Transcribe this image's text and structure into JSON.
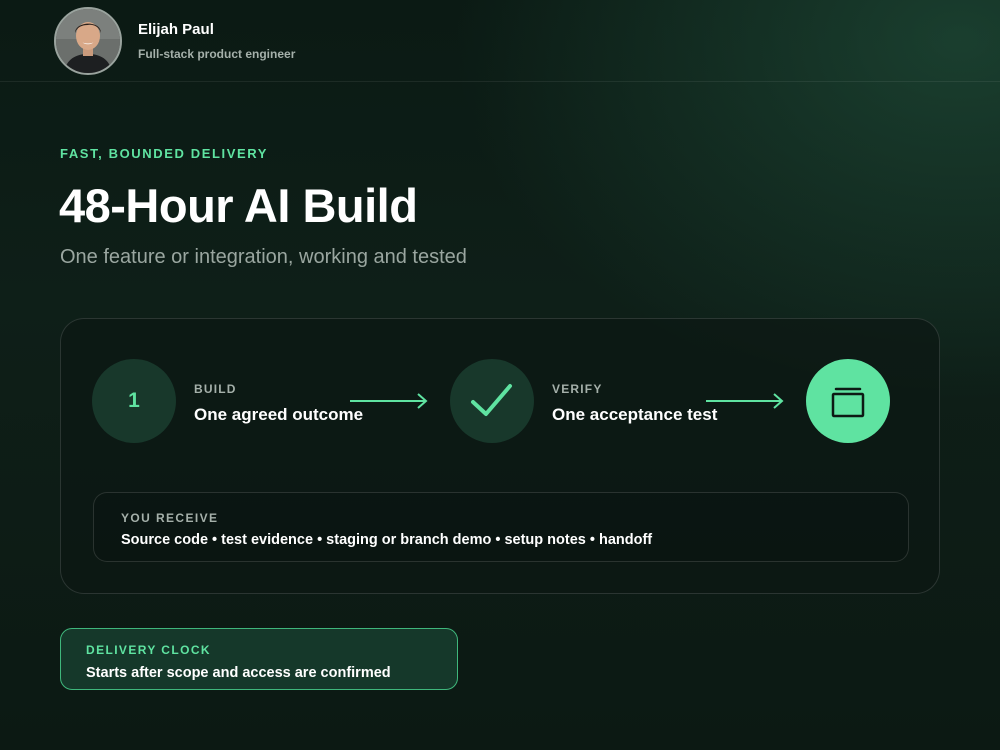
{
  "profile": {
    "name": "Elijah Paul",
    "role": "Full-stack product engineer",
    "avatar_icon": "person-photo"
  },
  "hero": {
    "eyebrow": "FAST, BOUNDED DELIVERY",
    "title": "48-Hour AI Build",
    "subtitle": "One feature or integration, working and tested"
  },
  "steps": [
    {
      "marker": "1",
      "label": "BUILD",
      "text": "One agreed outcome"
    },
    {
      "marker_icon": "check-icon",
      "label": "VERIFY",
      "text": "One acceptance test"
    },
    {
      "marker_icon": "package-icon"
    }
  ],
  "receive": {
    "label": "YOU RECEIVE",
    "text": "Source code • test evidence • staging or branch demo • setup notes • handoff"
  },
  "clock": {
    "label": "DELIVERY CLOCK",
    "text": "Starts after scope and access are confirmed"
  },
  "colors": {
    "accent": "#5fe3a1",
    "background": "#0e1f18",
    "step_circle": "#18382b",
    "clock_border": "#3fb77c"
  }
}
